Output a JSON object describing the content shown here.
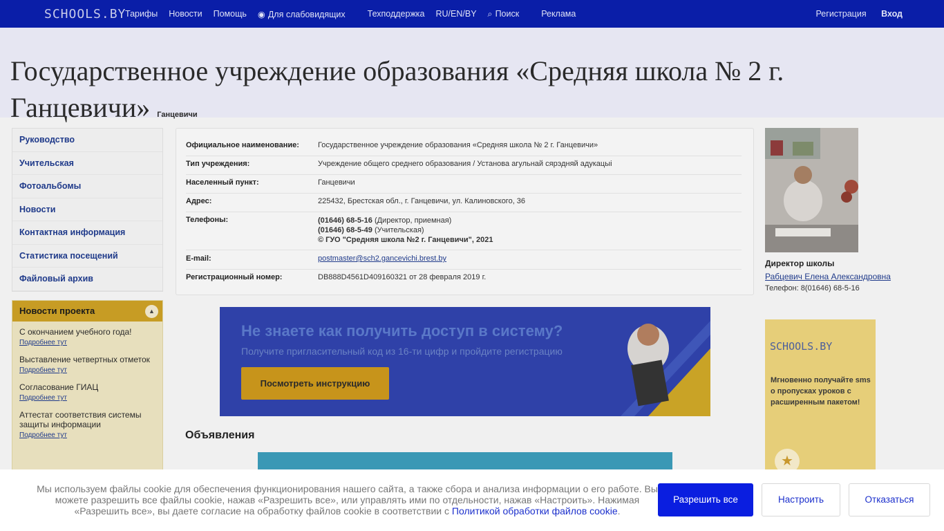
{
  "nav": {
    "logo": "SCHOOLS.BY",
    "links": [
      "Тарифы",
      "Новости",
      "Помощь",
      "Для слабовидящих",
      "Техподдержка",
      "RU/EN/BY",
      "Поиск",
      "Реклама"
    ],
    "register": "Регистрация",
    "login": "Вход"
  },
  "page": {
    "title": "Государственное учреждение образования «Средняя школа № 2 г. Ганцевичи»",
    "title_suffix": "Ганцевичи"
  },
  "sidebar": {
    "items": [
      "Руководство",
      "Учительская",
      "Фотоальбомы",
      "Новости",
      "Контактная информация",
      "Статистика посещений",
      "Файловый архив"
    ]
  },
  "project_news": {
    "header": "Новости проекта",
    "items": [
      {
        "title": "С окончанием учебного года!",
        "more": "Подробнее тут"
      },
      {
        "title": "Выставление четвертных отметок",
        "more": "Подробнее тут"
      },
      {
        "title": "Согласование ГИАЦ",
        "more": "Подробнее тут"
      },
      {
        "title": "Аттестат соответствия системы защиты информации",
        "more": "Подробнее тут"
      }
    ]
  },
  "info": {
    "official_name_label": "Официальное наименование:",
    "official_name": "Государственное учреждение образования «Средняя школа № 2 г. Ганцевичи»",
    "type_label": "Тип учреждения:",
    "type": "Учреждение общего среднего образования / Установа агульнай сярэдняй адукацыі",
    "locality_label": "Населенный пункт:",
    "locality": "Ганцевичи",
    "address_label": "Адрес:",
    "address": "225432, Брестская обл., г. Ганцевичи, ул. Калиновского, 36",
    "phones_label": "Телефоны:",
    "phone1_num": "(01646) 68-5-16",
    "phone1_note": " (Директор, приемная)",
    "phone2_num": "(01646) 68-5-49",
    "phone2_note": " (Учительская)",
    "copyright": "© ГУО \"Средняя школа №2 г. Ганцевичи\", 2021",
    "email_label": "E-mail:",
    "email": "postmaster@sch2.gancevichi.brest.by",
    "reg_label": "Регистрационный номер:",
    "reg": "DB888D4561D409160321 от 28 февраля 2019 г."
  },
  "director": {
    "title": "Директор школы",
    "name": "Рабцевич Елена Александровна",
    "phone": "Телефон: 8(01646) 68-5-16"
  },
  "banner": {
    "heading": "Не знаете как получить доступ в систему?",
    "text": "Получите пригласительный код из 16-ти цифр и пройдите регистрацию",
    "button": "Посмотреть инструкцию"
  },
  "announcements": {
    "heading": "Объявления"
  },
  "ad": {
    "logo": "SCHOOLS.BY",
    "text": "Мгновенно получайте sms о пропусках уроков с расширенным пакетом!"
  },
  "cookie": {
    "text": "Мы используем файлы cookie для обеспечения функционирования нашего сайта, а также сбора и анализа информации о его работе. Вы можете разрешить все файлы cookie, нажав «Разрешить все», или управлять ими по отдельности, нажав «Настроить». Нажимая «Разрешить все», вы даете согласие на обработку файлов cookie в соответствии с ",
    "link": "Политикой обработки файлов cookie",
    "tail": ".",
    "allow": "Разрешить все",
    "setup": "Настроить",
    "decline": "Отказаться"
  }
}
